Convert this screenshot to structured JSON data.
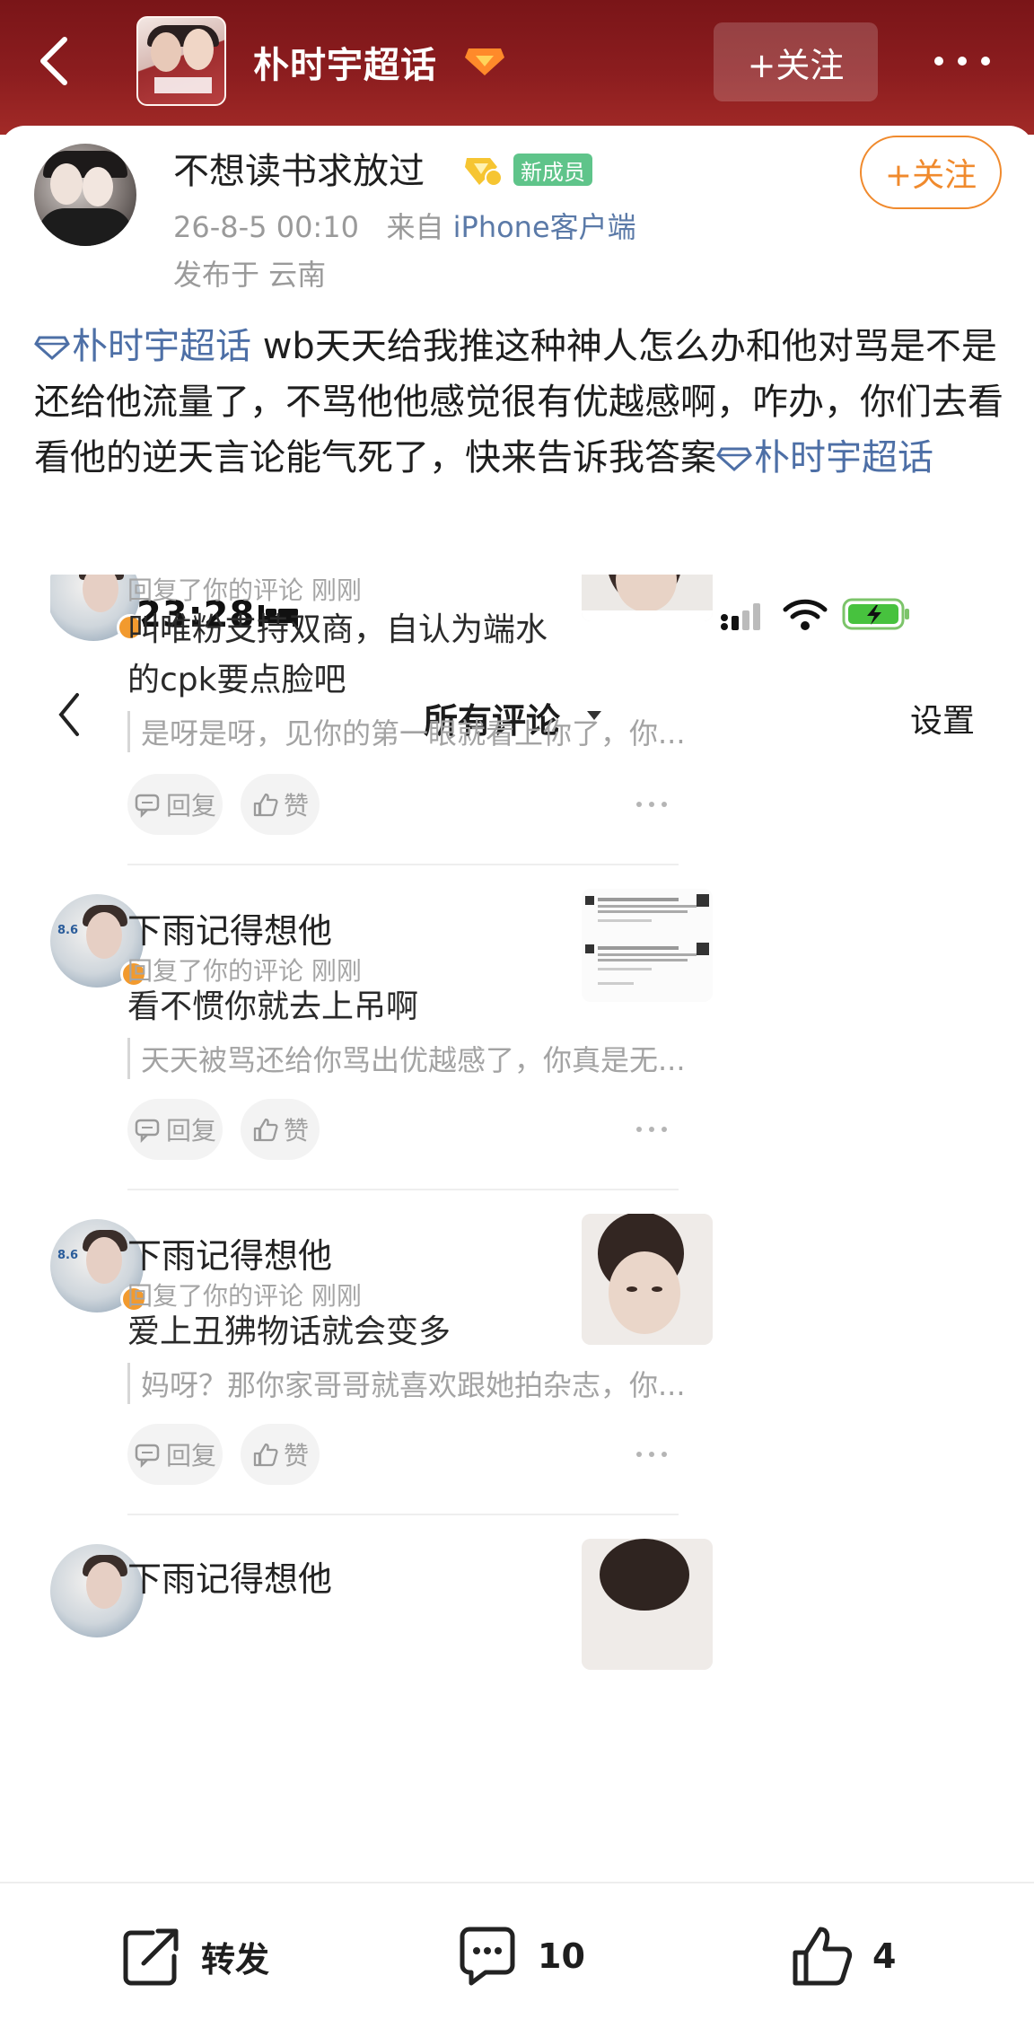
{
  "header": {
    "title": "朴时宇超话",
    "follow_label": "+关注"
  },
  "post": {
    "username": "不想读书求放过",
    "badge_new": "新成员",
    "follow_label": "+关注",
    "timestamp": "26-8-5 00:10",
    "source_prefix": "来自",
    "source": "iPhone客户端",
    "location": "发布于 云南",
    "topic_tag_1": "朴时宇超话",
    "body": " wb天天给我推这种神人怎么办和他对骂是不是还给他流量了，不骂他他感觉很有优越感啊，咋办，你们去看看他的逆天言论能气死了，快来告诉我答案",
    "topic_tag_2": "朴时宇超话"
  },
  "screenshot": {
    "status_time": "23:28",
    "nav_title": "所有评论",
    "nav_settings": "设置",
    "comments": [
      {
        "name": "",
        "meta": "回复了你的评论  刚刚",
        "text": "叫唯粉支持双商，自认为端水的cpk要点脸吧",
        "quote": "是呀是呀，见你的第一眼就看上你了，你...",
        "reply": "回复",
        "like": "赞"
      },
      {
        "name": "下雨记得想他",
        "meta": "回复了你的评论  刚刚",
        "text": "看不惯你就去上吊啊",
        "quote": "天天被骂还给你骂出优越感了，你真是无...",
        "reply": "回复",
        "like": "赞"
      },
      {
        "name": "下雨记得想他",
        "meta": "回复了你的评论  刚刚",
        "text": "爱上丑狒物话就会变多",
        "quote": "妈呀？那你家哥哥就喜欢跟她拍杂志，你...",
        "reply": "回复",
        "like": "赞"
      },
      {
        "name": "下雨记得想他"
      }
    ]
  },
  "bottom_bar": {
    "repost_label": "转发",
    "comment_count": "10",
    "like_count": "4"
  },
  "colors": {
    "header_bg": "#8c1d1f",
    "follow_orange": "#f08a2d",
    "topic_link": "#4d6fa6",
    "new_member_green": "#5fc48a"
  }
}
